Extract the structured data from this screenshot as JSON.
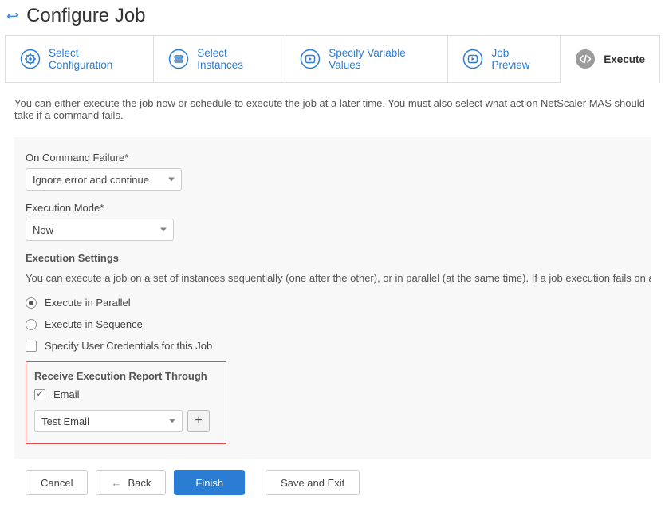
{
  "header": {
    "title": "Configure Job"
  },
  "tabs": {
    "select_config": "Select Configuration",
    "select_instances": "Select Instances",
    "specify_vars": "Specify Variable Values",
    "job_preview": "Job Preview",
    "execute": "Execute"
  },
  "description": "You can either execute the job now or schedule to execute the job at a later time. You must also select what action NetScaler MAS should take if a command fails.",
  "fields": {
    "on_command_failure_label": "On Command Failure*",
    "on_command_failure_value": "Ignore error and continue",
    "execution_mode_label": "Execution Mode*",
    "execution_mode_value": "Now"
  },
  "exec_settings": {
    "heading": "Execution Settings",
    "description": "You can execute a job on a set of instances sequentially (one after the other), or in parallel (at the same time). If a job execution fails on any instance, it does not conti",
    "parallel": "Execute in Parallel",
    "sequence": "Execute in Sequence",
    "specify_creds": "Specify User Credentials for this Job"
  },
  "report": {
    "heading": "Receive Execution Report Through",
    "email_label": "Email",
    "email_select_value": "Test Email"
  },
  "buttons": {
    "cancel": "Cancel",
    "back": "Back",
    "finish": "Finish",
    "save_exit": "Save and Exit"
  }
}
